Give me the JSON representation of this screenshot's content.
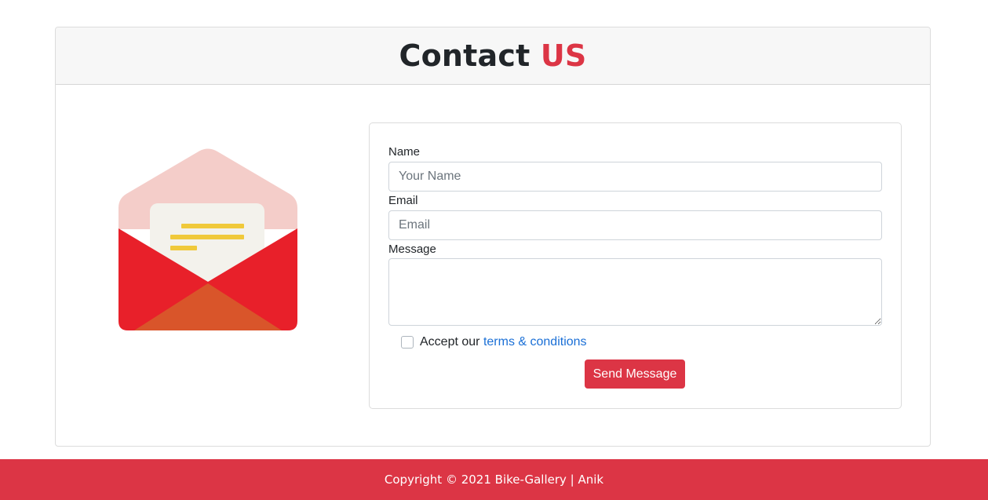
{
  "header": {
    "title_main": "Contact",
    "title_accent": "US",
    "accent_color": "#dc3545"
  },
  "illustration": {
    "icon": "open-envelope-icon"
  },
  "form": {
    "name_label": "Name",
    "name_placeholder": "Your Name",
    "name_value": "",
    "email_label": "Email",
    "email_placeholder": "Email",
    "email_value": "",
    "message_label": "Message",
    "message_value": "",
    "accept_prefix": "Accept our ",
    "terms_link": "terms & conditions",
    "accept_checked": false,
    "submit_label": "Send Message"
  },
  "footer": {
    "text": "Copyright © 2021 Bike-Gallery | Anik",
    "color": "#dc3545"
  }
}
